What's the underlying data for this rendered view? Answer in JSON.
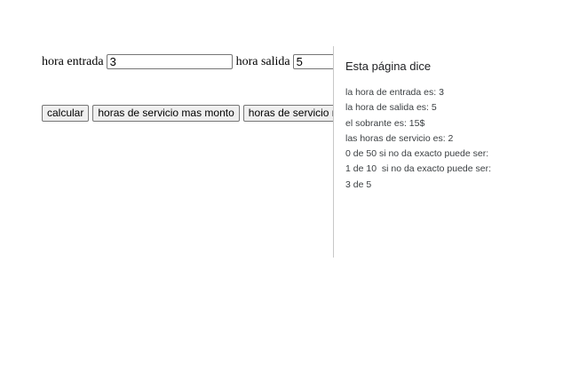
{
  "form": {
    "entrada_label": "hora entrada",
    "entrada_value": "3",
    "salida_label": "hora salida",
    "salida_value": "5"
  },
  "buttons": {
    "calcular": "calcular",
    "horas_monto": "horas de servicio mas monto",
    "horas_m": "horas de servicio mas m"
  },
  "dialog": {
    "title": "Esta página dice",
    "lines": [
      "la hora de entrada es: 3",
      "la hora de salida es: 5",
      "el sobrante es: 15$",
      "las horas de servicio es: 2",
      "0 de 50 si no da exacto puede ser:",
      "1 de 10  si no da exacto puede ser:",
      "3 de 5"
    ]
  }
}
